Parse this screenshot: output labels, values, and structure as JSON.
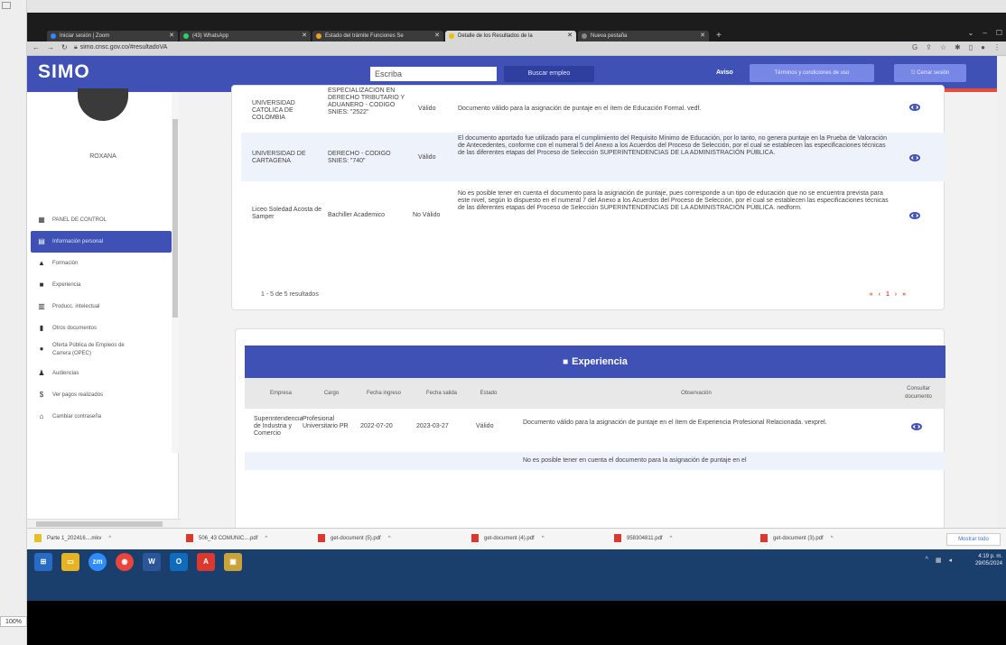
{
  "browser": {
    "tabs": [
      {
        "label": "Iniciar sesión | Zoom",
        "color": "#2d8cff"
      },
      {
        "label": "(43) WhatsApp",
        "color": "#25d366"
      },
      {
        "label": "Estado del trámite Funciones Se",
        "color": "#f0a020"
      },
      {
        "label": "Detalle de los Resultados de la",
        "color": "#e6c200",
        "active": true
      },
      {
        "label": "Nueva pestaña",
        "color": "#888888"
      }
    ],
    "url": "simo.cnsc.gov.co/#resultadoVA"
  },
  "header": {
    "logo": "SIMO",
    "search_value": "Escriba",
    "search_button": "Buscar empleo",
    "user_link": "Aviso",
    "terms_button": "Términos y condiciones de uso",
    "logout_button": "Cerrar sesión"
  },
  "sidebar": {
    "user_name": "ROXANA",
    "items": [
      {
        "label": "PANEL DE CONTROL",
        "icon": "dashboard-icon"
      },
      {
        "label": "Información personal",
        "icon": "id-card-icon",
        "active": true
      },
      {
        "label": "Formación",
        "icon": "graduation-cap-icon"
      },
      {
        "label": "Experiencia",
        "icon": "briefcase-icon"
      },
      {
        "label": "Producc. intelectual",
        "icon": "book-icon"
      },
      {
        "label": "Otros documentos",
        "icon": "document-icon"
      },
      {
        "label": "Oferta Pública de Empleos de Carrera (OPEC)",
        "icon": "globe-icon"
      },
      {
        "label": "Audiencias",
        "icon": "audience-icon"
      },
      {
        "label": "Ver pagos realizados",
        "icon": "dollar-icon"
      },
      {
        "label": "Cambiar contraseña",
        "icon": "lock-icon"
      }
    ]
  },
  "education": {
    "rows": [
      {
        "institution": "UNIVERSIDAD CATOLICA DE COLOMBIA",
        "program": "ESPECIALIZACION EN DERECHO TRIBUTARIO Y ADUANERO - CODIGO SNIES: \"2522\"",
        "status": "Válido",
        "observation": "Documento válido para la asignación de puntaje en el ítem de Educación Formal. vedf."
      },
      {
        "institution": "UNIVERSIDAD DE CARTAGENA",
        "program": "DERECHO - CODIGO SNIES: \"740\"",
        "status": "Válido",
        "observation": "El documento aportado fue utilizado para el cumplimiento del Requisito Mínimo de Educación, por lo tanto, no genera puntaje en la Prueba de Valoración de Antecedentes, conforme con el numeral 5 del Anexo a los Acuerdos del Proceso de Selección, por el cual se establecen las especificaciones técnicas de las diferentes etapas del Proceso de Selección SUPERINTENDENCIAS DE LA ADMINISTRACIÓN PÚBLICA."
      },
      {
        "institution": "Liceo Soledad Acosta de Samper",
        "program": "Bachiller Academico",
        "status": "No Válido",
        "observation": "No es posible tener en cuenta el documento para la asignación de puntaje, pues corresponde a un tipo de educación que no se encuentra prevista para este nivel, según lo dispuesto en el numeral 7 del Anexo a los Acuerdos del Proceso de Selección, por el cual se establecen las especificaciones técnicas de las diferentes etapas del Proceso de Selección SUPERINTENDENCIAS DE LA ADMINISTRACIÓN PÚBLICA. nedform."
      }
    ],
    "results_text": "1 - 5 de 5 resultados",
    "pager_first": "«",
    "pager_prev": "‹",
    "pager_current": "1",
    "pager_next": "›",
    "pager_last": "»"
  },
  "experience": {
    "title": "Experiencia",
    "columns": [
      "Empresa",
      "Cargo",
      "Fecha ingreso",
      "Fecha salida",
      "Estado",
      "Observación",
      "Consultar documento"
    ],
    "rows": [
      {
        "company": "Superintendencia de Industria y Comercio",
        "position": "Profesional Universitario PR",
        "start": "2022-07-20",
        "end": "2023-03-27",
        "status": "Válido",
        "observation": "Documento válido para la asignación de puntaje en el ítem de Experiencia Profesional Relacionada. vexprel."
      }
    ],
    "partial_observation": "No es posible tener en cuenta el documento para la asignación de puntaje en el"
  },
  "downloads": [
    {
      "label": "Parte 1_202416....mkv",
      "type": "video"
    },
    {
      "label": "506_43 COMUNIC....pdf",
      "type": "pdf"
    },
    {
      "label": "get-document (5).pdf",
      "type": "pdf"
    },
    {
      "label": "get-document (4).pdf",
      "type": "pdf"
    },
    {
      "label": "958304811.pdf",
      "type": "pdf"
    },
    {
      "label": "get-document (3).pdf",
      "type": "pdf"
    }
  ],
  "downloads_show_all": "Mostrar todo",
  "taskbar": {
    "time": "4:19 p. m.",
    "date": "29/05/2024"
  },
  "zoom": "100%"
}
